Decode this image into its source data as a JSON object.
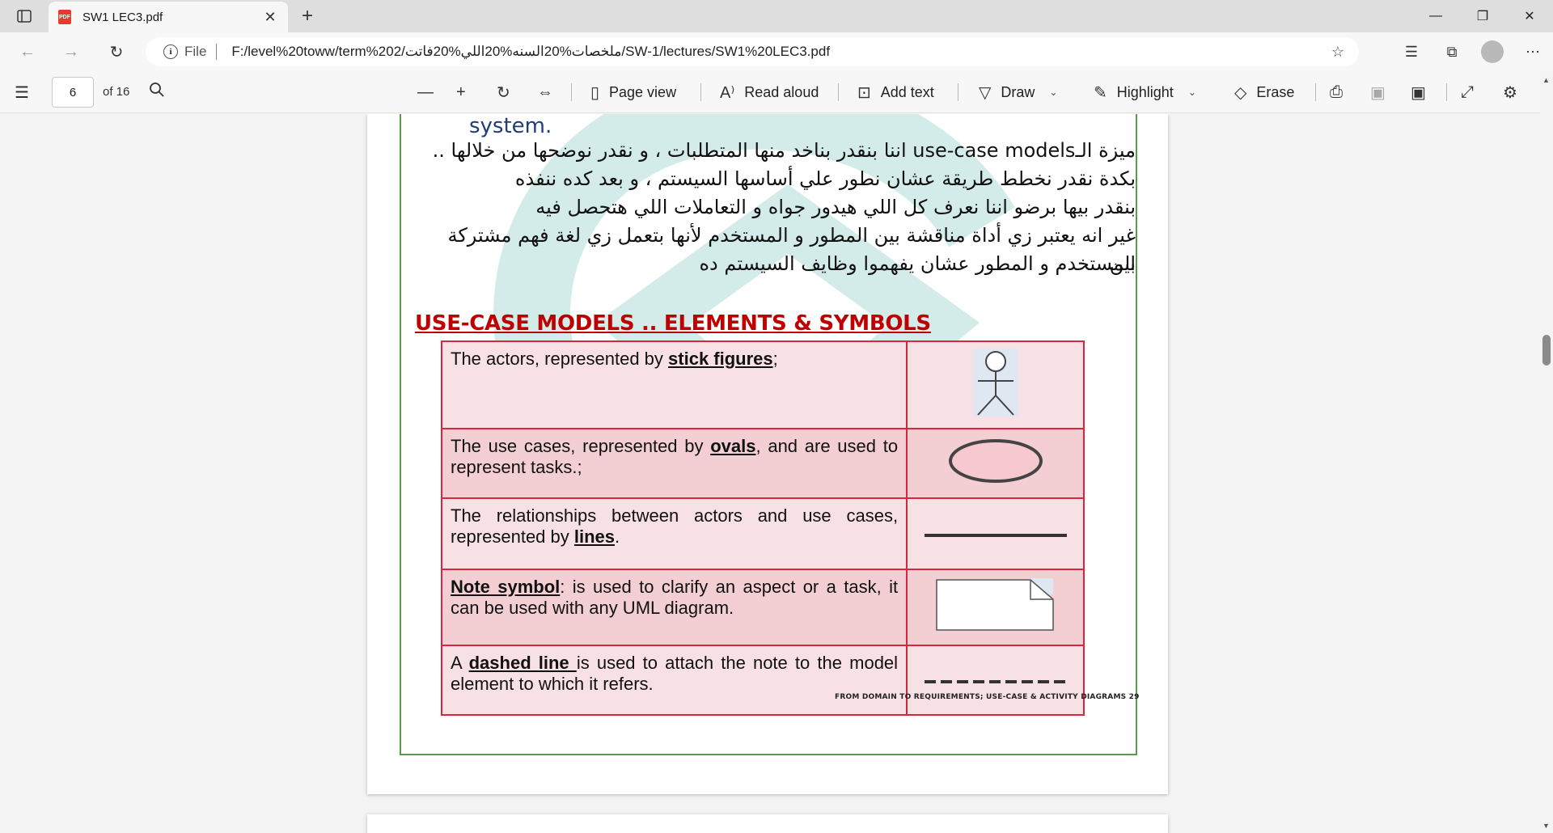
{
  "browser": {
    "tab_title": "SW1 LEC3.pdf",
    "pdf_badge": "PDF",
    "address_scheme": "File",
    "address_url": "F:/level%20toww/term%202/ملخصات%20السنه%20اللي%20فاتت/SW-1/lectures/SW1%20LEC3.pdf"
  },
  "pdf_toolbar": {
    "page_number": "6",
    "page_total": "of 16",
    "page_view": "Page view",
    "read_aloud": "Read aloud",
    "add_text": "Add text",
    "draw": "Draw",
    "highlight": "Highlight",
    "erase": "Erase"
  },
  "document": {
    "system_word": "system.",
    "arabic_lines": [
      "ميزة الـuse-case models اننا بنقدر بناخد منها المتطلبات ، و نقدر نوضحها من خلالها ..",
      "بكدة نقدر نخطط طريقة عشان نطور علي أساسها السيستم ، و بعد كده ننفذه",
      "بنقدر بيها برضو اننا نعرف كل اللي هيدور جواه و التعاملات اللي هتحصل فيه",
      "غير انه يعتبر زي أداة مناقشة بين المطور و المستخدم لأنها بتعمل زي لغة فهم مشتركة بين",
      "المستخدم و المطور عشان يفهموا وظايف السيستم ده"
    ],
    "heading": "USE-CASE MODELS .. ELEMENTS & SYMBOLS",
    "rows": [
      {
        "pre": "The actors, represented by ",
        "key": "stick figures",
        "post": ";"
      },
      {
        "pre": "The use cases, represented by ",
        "key": "ovals",
        "post": ", and are used to represent tasks.;"
      },
      {
        "pre": "The relationships between actors and use cases, represented by ",
        "key": "lines",
        "post": "."
      },
      {
        "pre": "",
        "key": "Note symbol",
        "post": ": is used to clarify an aspect or a task, it can be used with any UML diagram."
      },
      {
        "pre": "A ",
        "key": "dashed line ",
        "post": "is used to attach the note to the model element to which it refers."
      }
    ],
    "footer": "FROM DOMAIN TO REQUIREMENTS; USE-CASE & ACTIVITY DIAGRAMS     29"
  },
  "colors": {
    "heading": "#c00000",
    "table_border": "#d7263d",
    "frame": "#5b9a4a",
    "watermark": "#d3ecea"
  }
}
